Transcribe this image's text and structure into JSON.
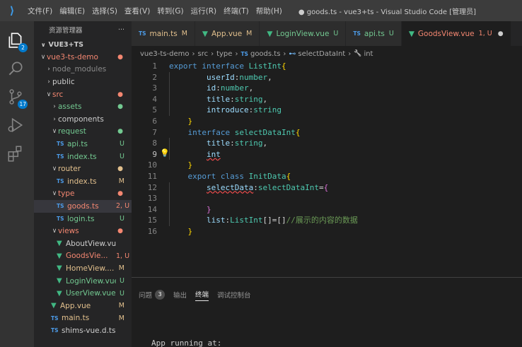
{
  "titlebar": {
    "menu": [
      "文件(F)",
      "编辑(E)",
      "选择(S)",
      "查看(V)",
      "转到(G)",
      "运行(R)",
      "终端(T)",
      "帮助(H)"
    ],
    "window_title": "● goods.ts - vue3+ts - Visual Studio Code [管理员]"
  },
  "activity": {
    "explorer_badge": "2",
    "scm_badge": "17"
  },
  "sidebar": {
    "header": "资源管理器",
    "more": "···",
    "project": "VUE3+TS",
    "tree": [
      {
        "label": "vue3-ts-demo",
        "depth": 1,
        "kind": "folder-open",
        "status": "●",
        "color": "err"
      },
      {
        "label": "node_modules",
        "depth": 2,
        "kind": "folder",
        "status": "",
        "color": "plain-dim"
      },
      {
        "label": "public",
        "depth": 2,
        "kind": "folder",
        "status": "",
        "color": "plain"
      },
      {
        "label": "src",
        "depth": 2,
        "kind": "folder-open",
        "status": "●",
        "color": "err"
      },
      {
        "label": "assets",
        "depth": 3,
        "kind": "folder",
        "status": "●",
        "color": "untr"
      },
      {
        "label": "components",
        "depth": 3,
        "kind": "folder",
        "status": "",
        "color": "plain"
      },
      {
        "label": "request",
        "depth": 3,
        "kind": "folder-open",
        "status": "●",
        "color": "untr"
      },
      {
        "label": "api.ts",
        "depth": 4,
        "kind": "ts",
        "status": "U",
        "color": "untr"
      },
      {
        "label": "index.ts",
        "depth": 4,
        "kind": "ts",
        "status": "U",
        "color": "untr"
      },
      {
        "label": "router",
        "depth": 3,
        "kind": "folder-open",
        "status": "●",
        "color": "mod"
      },
      {
        "label": "index.ts",
        "depth": 4,
        "kind": "ts",
        "status": "M",
        "color": "mod"
      },
      {
        "label": "type",
        "depth": 3,
        "kind": "folder-open",
        "status": "●",
        "color": "err"
      },
      {
        "label": "goods.ts",
        "depth": 4,
        "kind": "ts",
        "status": "2, U",
        "color": "err",
        "selected": true
      },
      {
        "label": "login.ts",
        "depth": 4,
        "kind": "ts",
        "status": "U",
        "color": "untr"
      },
      {
        "label": "views",
        "depth": 3,
        "kind": "folder-open",
        "status": "●",
        "color": "err"
      },
      {
        "label": "AboutView.vue",
        "depth": 4,
        "kind": "vue",
        "status": "",
        "color": "plain"
      },
      {
        "label": "GoodsVie...",
        "depth": 4,
        "kind": "vue",
        "status": "1, U",
        "color": "err"
      },
      {
        "label": "HomeView....",
        "depth": 4,
        "kind": "vue",
        "status": "M",
        "color": "mod"
      },
      {
        "label": "LoginView.vue",
        "depth": 4,
        "kind": "vue",
        "status": "U",
        "color": "untr"
      },
      {
        "label": "UserView.vue",
        "depth": 4,
        "kind": "vue",
        "status": "U",
        "color": "untr"
      },
      {
        "label": "App.vue",
        "depth": 3,
        "kind": "vue",
        "status": "M",
        "color": "mod"
      },
      {
        "label": "main.ts",
        "depth": 3,
        "kind": "ts",
        "status": "M",
        "color": "mod"
      },
      {
        "label": "shims-vue.d.ts",
        "depth": 3,
        "kind": "ts",
        "status": "",
        "color": "plain"
      }
    ]
  },
  "tabs": [
    {
      "label": "main.ts",
      "kind": "ts",
      "status": "M",
      "color": "mod"
    },
    {
      "label": "App.vue",
      "kind": "vue",
      "status": "M",
      "color": "mod"
    },
    {
      "label": "LoginView.vue",
      "kind": "vue",
      "status": "U",
      "color": "untr"
    },
    {
      "label": "api.ts",
      "kind": "ts",
      "status": "U",
      "color": "untr"
    },
    {
      "label": "GoodsView.vue",
      "kind": "vue",
      "status": "1, U",
      "color": "err",
      "dirty": "●"
    }
  ],
  "breadcrumb": [
    "vue3-ts-demo",
    "src",
    "type",
    "goods.ts",
    "selectDataInt",
    "int"
  ],
  "breadcrumb_icons": {
    "ts": "TS",
    "interface": "⊷",
    "property": "🔧"
  },
  "editor": {
    "current_line": 9,
    "lines": [
      {
        "n": "1",
        "tokens": [
          [
            "kw",
            "export "
          ],
          [
            "kw",
            "interface "
          ],
          [
            "cls",
            "ListInt"
          ],
          [
            "br",
            "{"
          ]
        ]
      },
      {
        "n": "2",
        "tokens": [
          [
            "",
            "        "
          ],
          [
            "prop",
            "userId"
          ],
          [
            "pun",
            ":"
          ],
          [
            "tp",
            "number"
          ],
          [
            "pun",
            ","
          ]
        ]
      },
      {
        "n": "3",
        "tokens": [
          [
            "",
            "        "
          ],
          [
            "prop",
            "id"
          ],
          [
            "pun",
            ":"
          ],
          [
            "tp",
            "number"
          ],
          [
            "pun",
            ","
          ]
        ]
      },
      {
        "n": "4",
        "tokens": [
          [
            "",
            "        "
          ],
          [
            "prop",
            "title"
          ],
          [
            "pun",
            ":"
          ],
          [
            "tp",
            "string"
          ],
          [
            "pun",
            ","
          ]
        ]
      },
      {
        "n": "5",
        "tokens": [
          [
            "",
            "        "
          ],
          [
            "prop",
            "introduce"
          ],
          [
            "pun",
            ":"
          ],
          [
            "tp",
            "string"
          ]
        ]
      },
      {
        "n": "6",
        "tokens": [
          [
            "",
            "    "
          ],
          [
            "br",
            "}"
          ]
        ]
      },
      {
        "n": "7",
        "tokens": [
          [
            "",
            "    "
          ],
          [
            "kw",
            "interface "
          ],
          [
            "cls",
            "selectDataInt"
          ],
          [
            "br",
            "{"
          ]
        ]
      },
      {
        "n": "8",
        "tokens": [
          [
            "",
            "        "
          ],
          [
            "prop",
            "title"
          ],
          [
            "pun",
            ":"
          ],
          [
            "tp",
            "string"
          ],
          [
            "pun",
            ","
          ]
        ]
      },
      {
        "n": "9",
        "tokens": [
          [
            "",
            "        "
          ],
          [
            "sq",
            "int"
          ]
        ]
      },
      {
        "n": "10",
        "tokens": [
          [
            "",
            "    "
          ],
          [
            "br",
            "}"
          ]
        ]
      },
      {
        "n": "11",
        "tokens": [
          [
            "",
            "    "
          ],
          [
            "kw",
            "export "
          ],
          [
            "kw",
            "class "
          ],
          [
            "cls",
            "InitData"
          ],
          [
            "br",
            "{"
          ]
        ]
      },
      {
        "n": "12",
        "tokens": [
          [
            "",
            "        "
          ],
          [
            "sqp",
            "selectData"
          ],
          [
            "pun",
            ":"
          ],
          [
            "tp",
            "selectDataInt"
          ],
          [
            "pun",
            "="
          ],
          [
            "br2",
            "{"
          ]
        ]
      },
      {
        "n": "13",
        "tokens": []
      },
      {
        "n": "14",
        "tokens": [
          [
            "",
            "        "
          ],
          [
            "br2",
            "}"
          ]
        ]
      },
      {
        "n": "15",
        "tokens": [
          [
            "",
            "        "
          ],
          [
            "prop",
            "list"
          ],
          [
            "pun",
            ":"
          ],
          [
            "tp",
            "ListInt"
          ],
          [
            "pun",
            "[]=[]"
          ],
          [
            "cmt",
            "//展示的内容的数据"
          ]
        ]
      },
      {
        "n": "16",
        "tokens": [
          [
            "",
            "    "
          ],
          [
            "br",
            "}"
          ]
        ]
      }
    ]
  },
  "panel": {
    "tabs": [
      "问题",
      "输出",
      "终端",
      "调试控制台"
    ],
    "problems_count": "3",
    "active_tab": "终端",
    "terminal_text": "App running at:"
  }
}
